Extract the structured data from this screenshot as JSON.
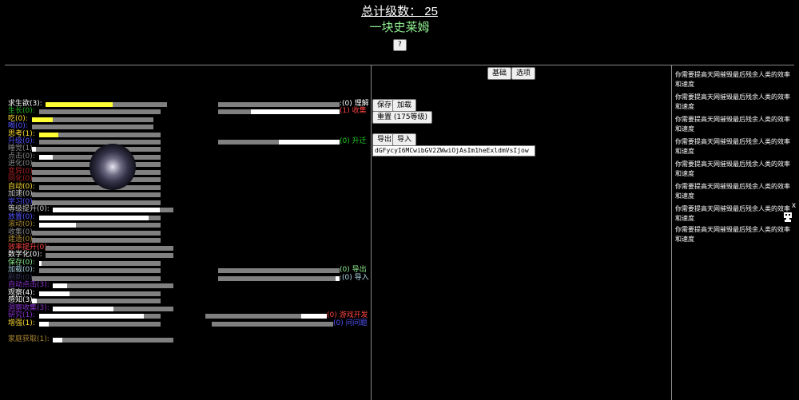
{
  "header": {
    "total_label": "总计级数：",
    "total_value": "25",
    "subtitle": "一块史莱姆",
    "help_button": "?",
    "subtitle_color": "#90ee90"
  },
  "tabs": {
    "basic": "基础",
    "options": "选项"
  },
  "controls": {
    "save": "保存",
    "load": "加载",
    "reset": "重置 (175等级)",
    "export": "导出",
    "import": "导入",
    "save_code": "dGFycyI6MCwibGV2ZWwiOjAsIm1heExldmVsIjow"
  },
  "stats": [
    {
      "label": "求生欲(3):",
      "color": "#ffffff",
      "fill_color": "#ffff33",
      "fill": 0.55
    },
    {
      "label": "生长(0):",
      "color": "#22bb22",
      "fill_color": "#ffffff",
      "fill": 0.0
    },
    {
      "label": "吃(0):",
      "color": "#ffdd33",
      "fill_color": "#ffff33",
      "fill": 0.17
    },
    {
      "label": "喝(0):",
      "color": "#5555ff",
      "fill_color": "#ffffff",
      "fill": 0.0
    },
    {
      "label": "思考(1):",
      "color": "#ffdd33",
      "fill_color": "#ffff33",
      "fill": 0.16
    },
    {
      "label": "升级(0):",
      "color": "#5555ff",
      "fill_color": "#ffffff",
      "fill": 0.0
    },
    {
      "label": "睡觉(1):",
      "color": "#888888",
      "fill_color": "#ffffff",
      "fill": 0.03
    },
    {
      "label": "点击(0):",
      "color": "#888888",
      "fill_color": "#ffffff",
      "fill": 0.11
    },
    {
      "label": "进化(0):",
      "color": "#888888",
      "fill_color": "#ffffff",
      "fill": 0.0
    },
    {
      "label": "变异(0):",
      "color": "#aa2222",
      "fill_color": "#ffffff",
      "fill": 0.0
    },
    {
      "label": "同化(0):",
      "color": "#aa2222",
      "fill_color": "#ffffff",
      "fill": 0.0
    },
    {
      "label": "自动(0):",
      "color": "#ffdd33",
      "fill_color": "#ffffff",
      "fill": 0.0
    },
    {
      "label": "加速(0):",
      "color": "#cccccc",
      "fill_color": "#ffffff",
      "fill": 0.0
    },
    {
      "label": "学习(0):",
      "color": "#5555ff",
      "fill_color": "#ffffff",
      "fill": 0.0
    },
    {
      "label": "等级提升(0):",
      "color": "#cccccc",
      "fill_color": "#ffffff",
      "fill": 0.89
    },
    {
      "label": "放置(0):",
      "color": "#5555ff",
      "fill_color": "#ffffff",
      "fill": 0.9
    },
    {
      "label": "滚动(0):",
      "color": "#aa8833",
      "fill_color": "#ffffff",
      "fill": 0.3
    },
    {
      "label": "收集(0):",
      "color": "#888888",
      "fill_color": "#ffffff",
      "fill": 0.0
    },
    {
      "label": "建造(0):",
      "color": "#aa8833",
      "fill_color": "#ffffff",
      "fill": 0.0
    },
    {
      "label": "效率提升(0):",
      "color": "#ff4444",
      "fill_color": "#ffffff",
      "fill": 0.0
    },
    {
      "label": "数学化(0):",
      "color": "#ffffff",
      "fill_color": "#ffffff",
      "fill": 0.0
    },
    {
      "label": "保存(0):",
      "color": "#90ee90",
      "fill_color": "#ffffff",
      "fill": 0.02
    },
    {
      "label": "加载(0):",
      "color": "#add8e6",
      "fill_color": "#ffffff",
      "fill": 0.0
    },
    {
      "label": "刷新(0):",
      "color": "#333355",
      "fill_color": "#ffffff",
      "fill": 0.0
    },
    {
      "label": "自动点击(3):",
      "color": "#8833cc",
      "fill_color": "#ffffff",
      "fill": 0.12
    },
    {
      "label": "观察(4):",
      "color": "#ffffff",
      "fill_color": "#ffffff",
      "fill": 0.25
    },
    {
      "label": "感知(3):",
      "color": "#ffffff",
      "fill_color": "#ffffff",
      "fill": 0.04
    },
    {
      "label": "洞察收集(3):",
      "color": "#8833cc",
      "fill_color": "#ffffff",
      "fill": 0.5
    },
    {
      "label": "研究(1):",
      "color": "#8833cc",
      "fill_color": "#ffffff",
      "fill": 0.86
    },
    {
      "label": "增强(1):",
      "color": "#ffdd33",
      "fill_color": "#ffffff",
      "fill": 0.08
    },
    {
      "label": "家庭获取(1):",
      "color": "#aa8833",
      "fill_color": "#ffffff",
      "fill": 0.08
    }
  ],
  "right_bars": [
    {
      "label": ":(0) 理解",
      "color": "#ffffff",
      "fill": 0.0
    },
    {
      "label": "(1) 收集",
      "color": "#ff4444",
      "fill": 0.73
    },
    {
      "label": "(0) 升迁",
      "color": "#22cc22",
      "fill": 0.5
    },
    {
      "label": "(0) 导出",
      "color": "#90ee90",
      "fill": 0.0
    },
    {
      "label": ":(0) 导入",
      "color": "#add8e6",
      "fill": 0.03
    },
    {
      "label": "(0) 游戏开发",
      "color": "#ff4444",
      "fill": 0.21
    },
    {
      "label": "(0) 问问题",
      "color": "#5555ff",
      "fill": 0.0
    }
  ],
  "messages": [
    "你需要提高天网摧毁最后残余人类的效率和速度",
    "你需要提高天网摧毁最后残余人类的效率和速度",
    "你需要提高天网摧毁最后残余人类的效率和速度",
    "你需要提高天网摧毁最后残余人类的效率和速度",
    "你需要提高天网摧毁最后残余人类的效率和速度",
    "你需要提高天网摧毁最后残余人类的效率和速度",
    "你需要提高天网摧毁最后残余人类的效率和速度",
    "你需要提高天网摧毁最后残余人类的效率和速度"
  ],
  "close_label": "x"
}
